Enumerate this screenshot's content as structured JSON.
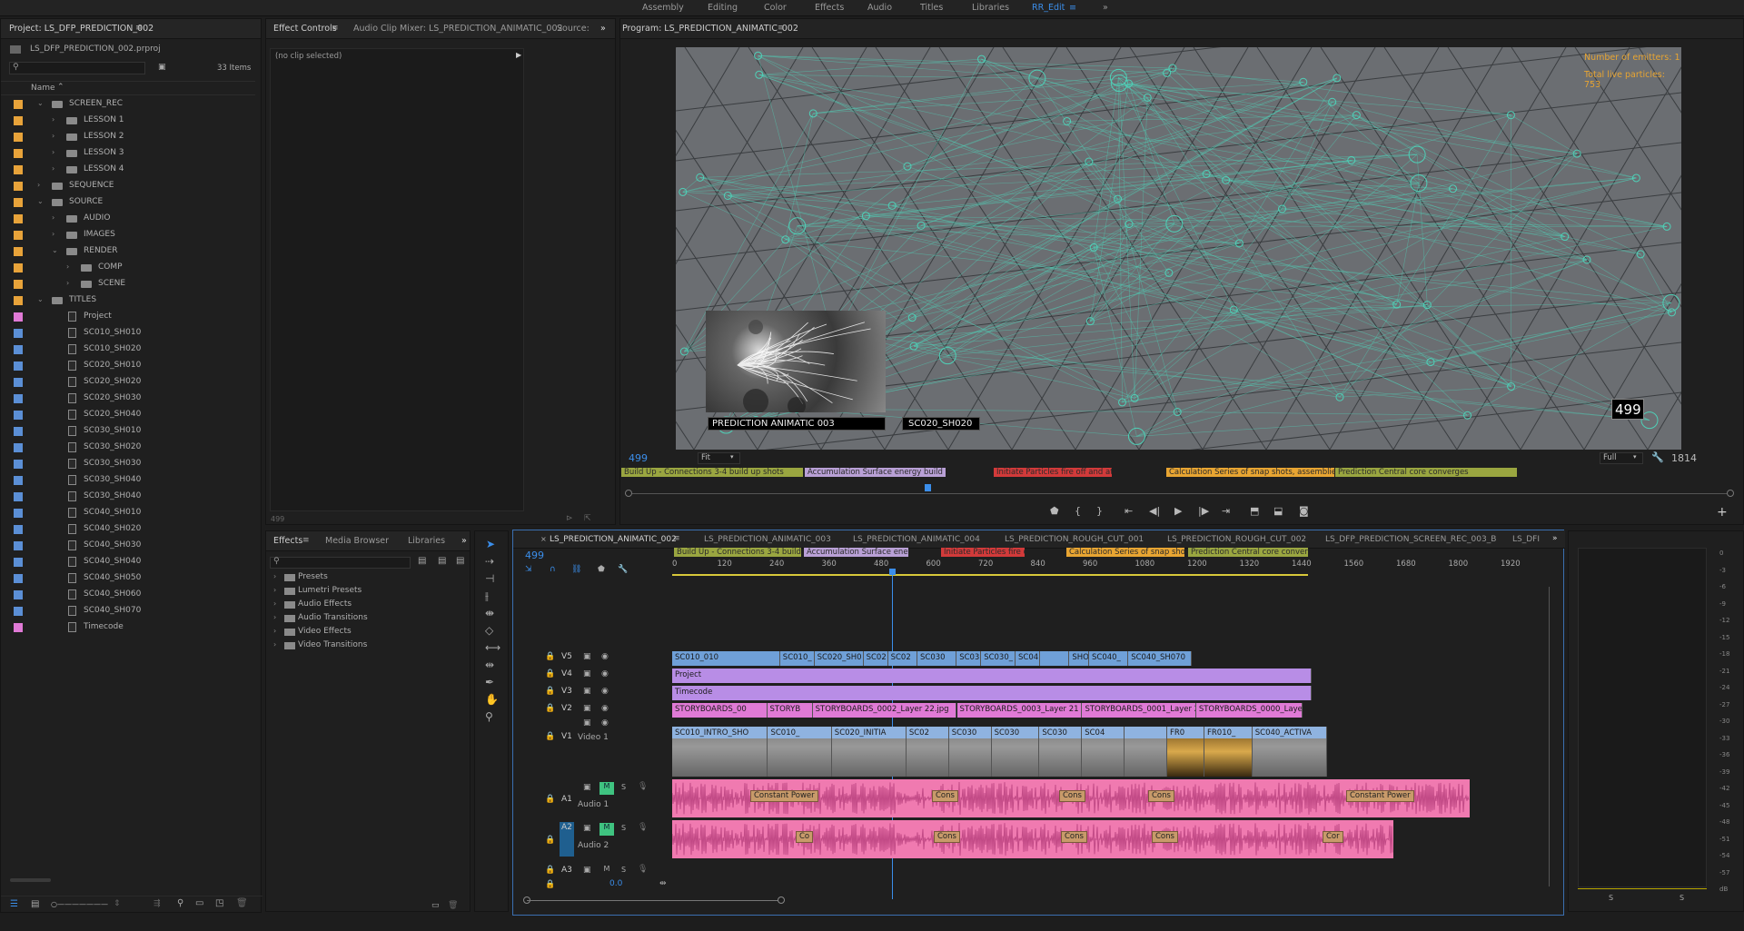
{
  "workspaces": [
    "Assembly",
    "Editing",
    "Color",
    "Effects",
    "Audio",
    "Titles",
    "Libraries",
    "RR_Edit"
  ],
  "workspace_active": "RR_Edit",
  "more_glyph": "»",
  "project": {
    "tab": "Project: LS_DFP_PREDICTION_002",
    "file": "LS_DFP_PREDICTION_002.prproj",
    "count": "33 Items",
    "col_name": "Name",
    "items": [
      {
        "label": "SCREEN_REC",
        "type": "folder",
        "depth": 0,
        "open": true,
        "color": "#e8a33a"
      },
      {
        "label": "LESSON 1",
        "type": "folder",
        "depth": 1,
        "open": false,
        "color": "#e8a33a"
      },
      {
        "label": "LESSON 2",
        "type": "folder",
        "depth": 1,
        "open": false,
        "color": "#e8a33a"
      },
      {
        "label": "LESSON 3",
        "type": "folder",
        "depth": 1,
        "open": false,
        "color": "#e8a33a"
      },
      {
        "label": "LESSON 4",
        "type": "folder",
        "depth": 1,
        "open": false,
        "color": "#e8a33a"
      },
      {
        "label": "SEQUENCE",
        "type": "folder",
        "depth": 0,
        "open": false,
        "color": "#e8a33a"
      },
      {
        "label": "SOURCE",
        "type": "folder",
        "depth": 0,
        "open": true,
        "color": "#e8a33a"
      },
      {
        "label": "AUDIO",
        "type": "folder",
        "depth": 1,
        "open": false,
        "color": "#e8a33a"
      },
      {
        "label": "IMAGES",
        "type": "folder",
        "depth": 1,
        "open": false,
        "color": "#e8a33a"
      },
      {
        "label": "RENDER",
        "type": "folder",
        "depth": 1,
        "open": true,
        "color": "#e8a33a"
      },
      {
        "label": "COMP",
        "type": "folder",
        "depth": 2,
        "open": false,
        "color": "#e8a33a"
      },
      {
        "label": "SCENE",
        "type": "folder",
        "depth": 2,
        "open": false,
        "color": "#e8a33a"
      },
      {
        "label": "TITLES",
        "type": "folder",
        "depth": 0,
        "open": true,
        "color": "#e8a33a"
      },
      {
        "label": "Project",
        "type": "file",
        "depth": 1,
        "color": "#e07ad6"
      },
      {
        "label": "SC010_SH010",
        "type": "file",
        "depth": 1,
        "color": "#5b8fd6"
      },
      {
        "label": "SC010_SH020",
        "type": "file",
        "depth": 1,
        "color": "#5b8fd6"
      },
      {
        "label": "SC020_SH010",
        "type": "file",
        "depth": 1,
        "color": "#5b8fd6"
      },
      {
        "label": "SC020_SH020",
        "type": "file",
        "depth": 1,
        "color": "#5b8fd6"
      },
      {
        "label": "SC020_SH030",
        "type": "file",
        "depth": 1,
        "color": "#5b8fd6"
      },
      {
        "label": "SC020_SH040",
        "type": "file",
        "depth": 1,
        "color": "#5b8fd6"
      },
      {
        "label": "SC030_SH010",
        "type": "file",
        "depth": 1,
        "color": "#5b8fd6"
      },
      {
        "label": "SC030_SH020",
        "type": "file",
        "depth": 1,
        "color": "#5b8fd6"
      },
      {
        "label": "SC030_SH030",
        "type": "file",
        "depth": 1,
        "color": "#5b8fd6"
      },
      {
        "label": "SC030_SH040",
        "type": "file",
        "depth": 1,
        "color": "#5b8fd6"
      },
      {
        "label": "SC030_SH040",
        "type": "file",
        "depth": 1,
        "color": "#5b8fd6"
      },
      {
        "label": "SC040_SH010",
        "type": "file",
        "depth": 1,
        "color": "#5b8fd6"
      },
      {
        "label": "SC040_SH020",
        "type": "file",
        "depth": 1,
        "color": "#5b8fd6"
      },
      {
        "label": "SC040_SH030",
        "type": "file",
        "depth": 1,
        "color": "#5b8fd6"
      },
      {
        "label": "SC040_SH040",
        "type": "file",
        "depth": 1,
        "color": "#5b8fd6"
      },
      {
        "label": "SC040_SH050",
        "type": "file",
        "depth": 1,
        "color": "#5b8fd6"
      },
      {
        "label": "SC040_SH060",
        "type": "file",
        "depth": 1,
        "color": "#5b8fd6"
      },
      {
        "label": "SC040_SH070",
        "type": "file",
        "depth": 1,
        "color": "#5b8fd6"
      },
      {
        "label": "Timecode",
        "type": "file",
        "depth": 1,
        "color": "#e07ad6"
      }
    ]
  },
  "effect_controls": {
    "tabs": [
      "Effect Controls",
      "Audio Clip Mixer: LS_PREDICTION_ANIMATIC_002",
      "Source:"
    ],
    "no_clip": "(no clip selected)",
    "timecode": "499"
  },
  "effects_panel": {
    "tabs": [
      "Effects",
      "Media Browser",
      "Libraries"
    ],
    "items": [
      "Presets",
      "Lumetri Presets",
      "Audio Effects",
      "Audio Transitions",
      "Video Effects",
      "Video Transitions"
    ]
  },
  "program": {
    "tab": "Program: LS_PREDICTION_ANIMATIC_002",
    "overlay_emitters": "Number of emitters: 1",
    "overlay_particles": "Total live particles: 753",
    "inset_title": "PREDICTION ANIMATIC 003",
    "inset_shot": "SC020_SH020",
    "frame_badge": "499",
    "timecode": "499",
    "fit": "Fit",
    "quality": "Full",
    "duration": "1814",
    "markers": [
      {
        "label": "Build Up - Connections 3-4 build up shots",
        "color": "#9aa640"
      },
      {
        "label": "Accumulation Surface energy build up - 2",
        "color": "#b9a0d6"
      },
      {
        "label": "Initiate Particles fire off and att",
        "color": "#d23a3a"
      },
      {
        "label": "Calculation Series of snap shots, assemblies,",
        "color": "#e8a532"
      },
      {
        "label": "Prediction Central core converges",
        "color": "#9aa640"
      }
    ]
  },
  "timeline": {
    "tabs": [
      "LS_PREDICTION_ANIMATIC_002",
      "LS_PREDICTION_ANIMATIC_003",
      "LS_PREDICTION_ANIMATIC_004",
      "LS_PREDICTION_ROUGH_CUT_001",
      "LS_PREDICTION_ROUGH_CUT_002",
      "LS_DFP_PREDICTION_SCREEN_REC_003_B",
      "LS_DFI"
    ],
    "timecode": "499",
    "ruler": [
      "0",
      "120",
      "240",
      "360",
      "480",
      "600",
      "720",
      "840",
      "960",
      "1080",
      "1200",
      "1320",
      "1440",
      "1560",
      "1680",
      "1800",
      "1920"
    ],
    "markers": [
      {
        "label": "Build Up - Connections 3-4 build up s",
        "color": "#9aa640"
      },
      {
        "label": "Accumulation Surface energ",
        "color": "#b9a0d6"
      },
      {
        "label": "Initiate Particles fire o",
        "color": "#d23a3a"
      },
      {
        "label": "Calculation Series of snap shots,",
        "color": "#e8a532"
      },
      {
        "label": "Prediction Central core converge",
        "color": "#9aa640"
      }
    ],
    "tracks": {
      "V5": "V5",
      "V4": "V4",
      "V3": "V3",
      "V2": "V2",
      "V1": "V1",
      "A1": "A1",
      "A2": "A2",
      "A3": "A3",
      "video1": "Video 1",
      "audio1": "Audio 1",
      "audio2": "Audio 2",
      "m": "M",
      "s": "S",
      "vol": "0.0"
    },
    "v5_clips": [
      "SC010_010",
      "SC010_",
      "SC020_SH0",
      "SC02",
      "SC02",
      "SC030",
      "SC03",
      "SC030_",
      "SC04",
      "",
      "SHO",
      "SC040_",
      "SC040_SH070"
    ],
    "v4_clip": "Project",
    "v3_clip": "Timecode",
    "v2_clips": [
      "STORYBOARDS_00",
      "STORYB",
      "STORYBOARDS_0002_Layer 22.jpg",
      "STORYBOARDS_0003_Layer 21",
      "STORYBOARDS_0001_Layer 2",
      "STORYBOARDS_0000_Layer"
    ],
    "v1_clips": [
      "SC010_INTRO_SHO",
      "SC010_",
      "SC020_INITIA",
      "SC02",
      "SC030",
      "SC030",
      "SC030",
      "SC04",
      "",
      "FR0",
      "FR010_",
      "SC040_ACTIVA"
    ],
    "a1_labels": [
      "Constant Power",
      "Cons",
      "Cons",
      "Cons",
      "Constant Power"
    ],
    "a2_labels": [
      "Co",
      "Cons",
      "Cons",
      "Cons",
      "Cor"
    ]
  },
  "meter_ticks": [
    "0",
    "-3",
    "-6",
    "-9",
    "-12",
    "-15",
    "-18",
    "-21",
    "-24",
    "-27",
    "-30",
    "-33",
    "-36",
    "-39",
    "-42",
    "-45",
    "-48",
    "-51",
    "-54",
    "-57",
    "dB"
  ],
  "meter_solo": [
    "S",
    "S"
  ]
}
